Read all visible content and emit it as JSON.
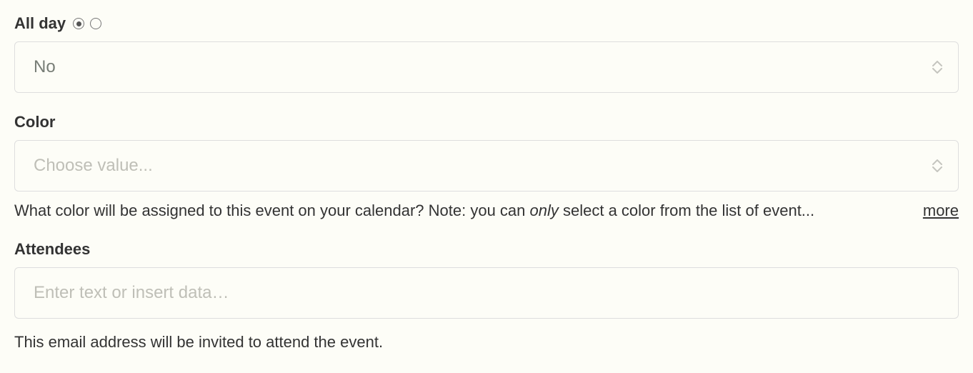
{
  "allday": {
    "label": "All day",
    "value": "No"
  },
  "color": {
    "label": "Color",
    "placeholder": "Choose value...",
    "helper_pre": "What color will be assigned to this event on your calendar? Note: you can ",
    "helper_em": "only",
    "helper_post": " select a color from the list of event...",
    "more": "more"
  },
  "attendees": {
    "label": "Attendees",
    "placeholder": "Enter text or insert data…",
    "helper": "This email address will be invited to attend the event."
  }
}
